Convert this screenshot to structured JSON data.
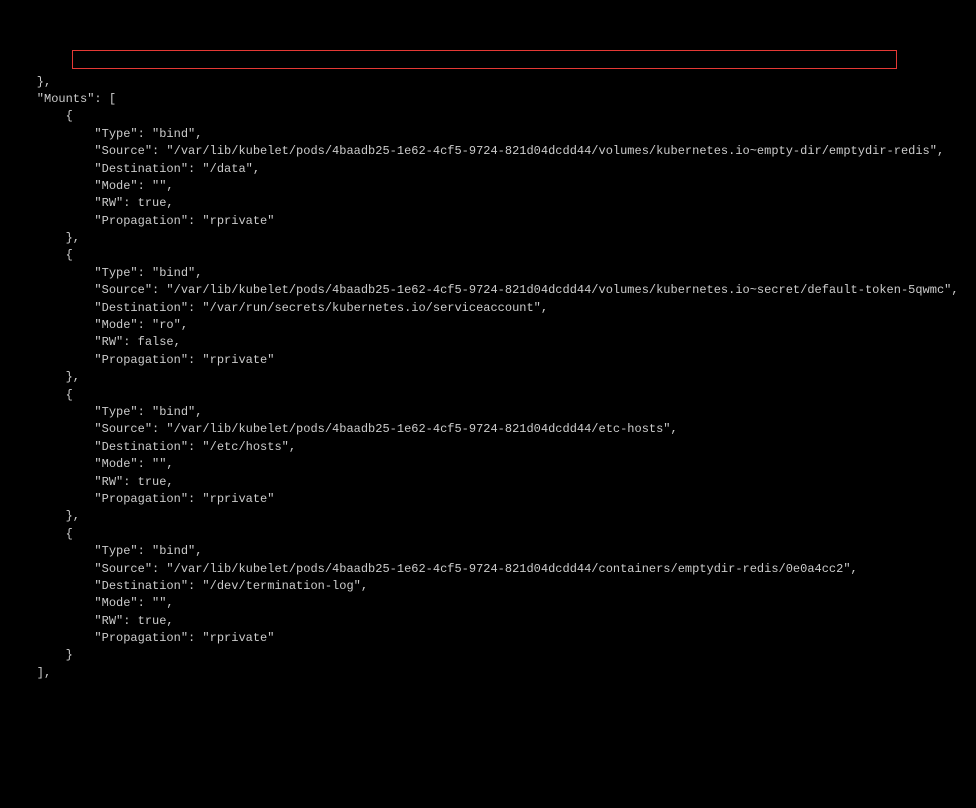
{
  "lines": {
    "l0": "    },",
    "l1": "    \"Mounts\": [",
    "l2": "        {",
    "l3": "            \"Type\": \"bind\",",
    "l4": "            \"Source\": \"/var/lib/kubelet/pods/4baadb25-1e62-4cf5-9724-821d04dcdd44/volumes/kubernetes.io~empty-dir/emptydir-redis\",",
    "l5": "            \"Destination\": \"/data\",",
    "l6": "            \"Mode\": \"\",",
    "l7": "            \"RW\": true,",
    "l8": "            \"Propagation\": \"rprivate\"",
    "l9": "        },",
    "l10": "        {",
    "l11": "            \"Type\": \"bind\",",
    "l12": "            \"Source\": \"/var/lib/kubelet/pods/4baadb25-1e62-4cf5-9724-821d04dcdd44/volumes/kubernetes.io~secret/default-token-5qwmc\",",
    "l13": "            \"Destination\": \"/var/run/secrets/kubernetes.io/serviceaccount\",",
    "l14": "            \"Mode\": \"ro\",",
    "l15": "            \"RW\": false,",
    "l16": "            \"Propagation\": \"rprivate\"",
    "l17": "        },",
    "l18": "        {",
    "l19": "            \"Type\": \"bind\",",
    "l20": "            \"Source\": \"/var/lib/kubelet/pods/4baadb25-1e62-4cf5-9724-821d04dcdd44/etc-hosts\",",
    "l21": "            \"Destination\": \"/etc/hosts\",",
    "l22": "            \"Mode\": \"\",",
    "l23": "            \"RW\": true,",
    "l24": "            \"Propagation\": \"rprivate\"",
    "l25": "        },",
    "l26": "        {",
    "l27": "            \"Type\": \"bind\",",
    "l28": "            \"Source\": \"/var/lib/kubelet/pods/4baadb25-1e62-4cf5-9724-821d04dcdd44/containers/emptydir-redis/0e0a4cc2\",",
    "l29": "            \"Destination\": \"/dev/termination-log\",",
    "l30": "            \"Mode\": \"\",",
    "l31": "            \"RW\": true,",
    "l32": "            \"Propagation\": \"rprivate\"",
    "l33": "        }",
    "l34": "    ],"
  }
}
